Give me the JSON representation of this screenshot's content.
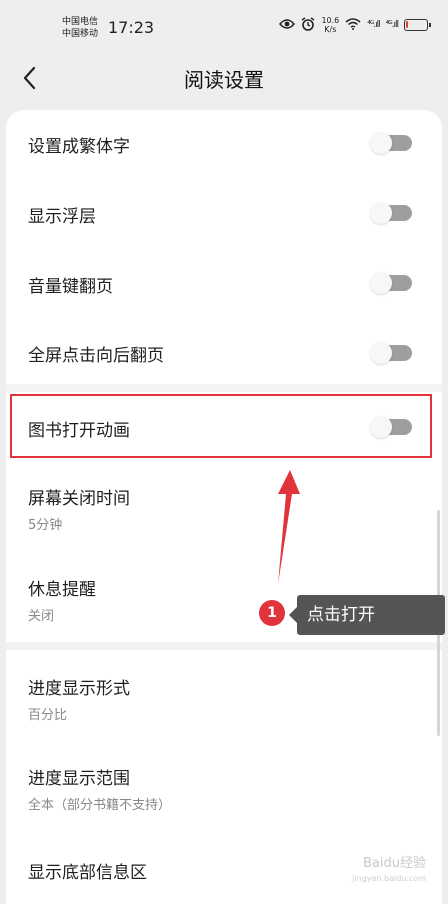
{
  "status_bar": {
    "carrier_1": "中国电信",
    "carrier_2": "中国移动",
    "time": "17:23",
    "speed_value": "10.6",
    "speed_unit": "K/s",
    "signal_1": "⁴ᴳ.ıll",
    "signal_2": "⁴ᴳ.ıll",
    "battery_color": "#e53935",
    "battery_level": 0.12
  },
  "header": {
    "title": "阅读设置",
    "back_icon": "chevron-left-icon"
  },
  "settings": {
    "rows": [
      {
        "label": "设置成繁体字",
        "toggle": false
      },
      {
        "label": "显示浮层",
        "toggle": false
      },
      {
        "label": "音量键翻页",
        "toggle": false
      },
      {
        "label": "全屏点击向后翻页",
        "toggle": false
      },
      {
        "label": "图书打开动画",
        "toggle": false
      },
      {
        "label": "屏幕关闭时间",
        "value": "5分钟"
      },
      {
        "label": "休息提醒",
        "value": "关闭"
      },
      {
        "label": "进度显示形式",
        "value": "百分比"
      },
      {
        "label": "进度显示范围",
        "value": "全本（部分书籍不支持）"
      },
      {
        "label": "显示底部信息区"
      }
    ]
  },
  "annotation": {
    "step_number": "1",
    "callout_text": "点击打开",
    "highlight_color": "#e0333b"
  },
  "watermark": {
    "text": "Baidu经验",
    "sub": "jingyan.baidu.com"
  }
}
